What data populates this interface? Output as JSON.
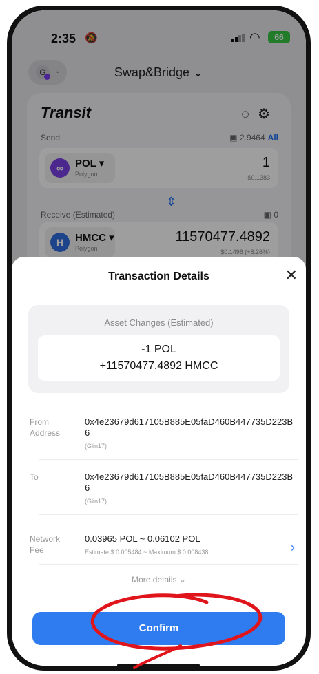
{
  "status": {
    "time": "2:35",
    "battery": "66"
  },
  "nav": {
    "avatar_letter": "G",
    "title": "Swap&Bridge ⌄"
  },
  "app": {
    "name": "Transit",
    "send_label": "Send",
    "balance": "2.9464",
    "balance_all": "All",
    "send_token": {
      "symbol": "POL ▾",
      "chain": "Polygon",
      "amount": "1",
      "usd": "$0.1383"
    },
    "receive_label": "Receive (Estimated)",
    "receive_balance": "0",
    "receive_token": {
      "symbol": "HMCC ▾",
      "chain": "Polygon",
      "amount": "11570477.4892",
      "usd": "$0.1498 (+8.26%)"
    }
  },
  "sheet": {
    "title": "Transaction Details",
    "asset_label": "Asset Changes (Estimated)",
    "asset_out": "-1 POL",
    "asset_in": "+11570477.4892 HMCC",
    "from_label_1": "From",
    "from_label_2": "Address",
    "from_address": "0x4e23679d617105B885E05faD460B447735D223B6",
    "from_name": "(Glin17)",
    "to_label": "To",
    "to_address": "0x4e23679d617105B885E05faD460B447735D223B6",
    "to_name": "(Glin17)",
    "fee_label_1": "Network",
    "fee_label_2": "Fee",
    "fee_value": "0.03965 POL ~ 0.06102 POL",
    "fee_sub": "Estimate $ 0.005484 ~ Maximum $ 0.008438",
    "more": "More details ⌄",
    "confirm": "Confirm"
  },
  "colors": {
    "accent": "#2f7bf0",
    "annotation": "#e0151c",
    "pol": "#7b3fe4",
    "hmcc": "#2f6fe0"
  }
}
